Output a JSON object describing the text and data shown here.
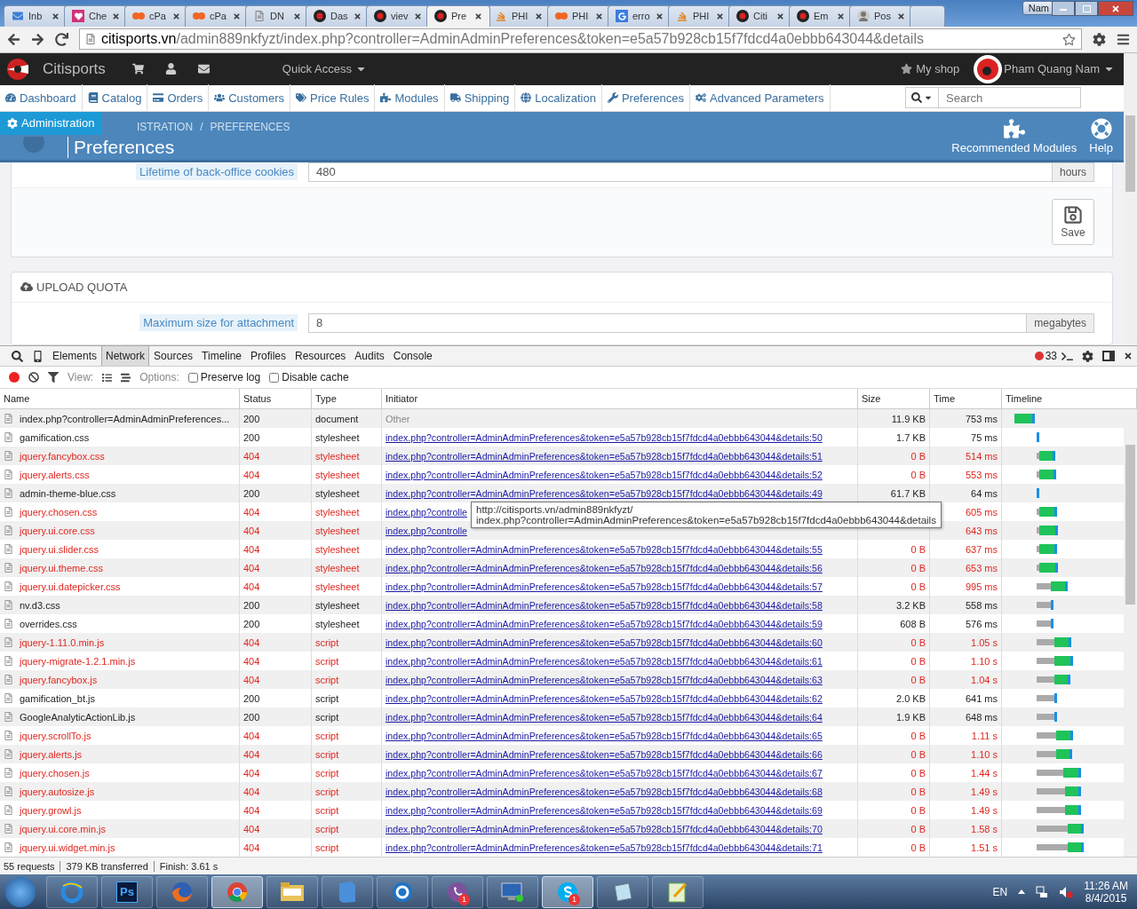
{
  "browser": {
    "tabs": [
      {
        "label": "Inb",
        "kind": "mail",
        "selected": false
      },
      {
        "label": "Che",
        "kind": "heart",
        "selected": false
      },
      {
        "label": "cPa",
        "kind": "cpanel",
        "selected": false
      },
      {
        "label": "cPa",
        "kind": "cpanel",
        "selected": false
      },
      {
        "label": "DN",
        "kind": "doc",
        "selected": false
      },
      {
        "label": "Das",
        "kind": "logo",
        "selected": false
      },
      {
        "label": "viev",
        "kind": "logo",
        "selected": false
      },
      {
        "label": "Pre",
        "kind": "logo",
        "selected": true
      },
      {
        "label": "PHI",
        "kind": "php",
        "selected": false
      },
      {
        "label": "PHI",
        "kind": "cpanel",
        "selected": false
      },
      {
        "label": "erro",
        "kind": "google",
        "selected": false
      },
      {
        "label": "PHI",
        "kind": "php",
        "selected": false
      },
      {
        "label": "Citi",
        "kind": "logo",
        "selected": false
      },
      {
        "label": "Em",
        "kind": "logo",
        "selected": false
      },
      {
        "label": "Pos",
        "kind": "person",
        "selected": false
      }
    ],
    "user_label": "Nam",
    "url_host": "citisports.vn",
    "url_path": "/admin889nkfyzt/index.php?controller=AdminAdminPreferences&token=e5a57b928cb15f7fdcd4a0ebbb643044&details"
  },
  "admin": {
    "shop_name": "Citisports",
    "quick_access": "Quick Access",
    "my_shop": "My shop",
    "user": "Pham Quang Nam",
    "menu": [
      "Dashboard",
      "Catalog",
      "Orders",
      "Customers",
      "Price Rules",
      "Modules",
      "Shipping",
      "Localization",
      "Preferences",
      "Advanced Parameters"
    ],
    "search_placeholder": "Search",
    "administration_button": "Administration",
    "breadcrumb": [
      "ISTRATION",
      "/",
      "PREFERENCES"
    ],
    "page_title": "Preferences",
    "toolbar": [
      "Recommended Modules",
      "Help"
    ],
    "cookie_field": {
      "label": "Lifetime of back-office cookies",
      "value": "480",
      "unit": "hours"
    },
    "save": "Save",
    "upload_panel": {
      "title": "UPLOAD QUOTA",
      "label": "Maximum size for attachment",
      "value": "8",
      "unit": "megabytes"
    }
  },
  "devtools": {
    "tabs": [
      {
        "label": "Elements",
        "selected": false
      },
      {
        "label": "Network",
        "selected": true
      },
      {
        "label": "Sources",
        "selected": false
      },
      {
        "label": "Timeline",
        "selected": false
      },
      {
        "label": "Profiles",
        "selected": false
      },
      {
        "label": "Resources",
        "selected": false
      },
      {
        "label": "Audits",
        "selected": false
      },
      {
        "label": "Console",
        "selected": false
      }
    ],
    "error_count": "33",
    "recording": true,
    "view_label": "View:",
    "options_label": "Options:",
    "options": [
      {
        "label": "Preserve log",
        "checked": false
      },
      {
        "label": "Disable cache",
        "checked": false
      }
    ],
    "columns": [
      "Name",
      "Status",
      "Type",
      "Initiator",
      "Size",
      "Time",
      "Timeline"
    ],
    "rows": [
      {
        "name": "index.php?controller=AdminAdminPreferences...",
        "status": "200",
        "type": "document",
        "initiator": "Other",
        "link": false,
        "size": "11.9 KB",
        "time": "753 ms",
        "failed": false
      },
      {
        "name": "gamification.css",
        "status": "200",
        "type": "stylesheet",
        "initiator": "index.php?controller=AdminAdminPreferences&token=e5a57b928cb15f7fdcd4a0ebbb643044&details:50",
        "link": true,
        "size": "1.7 KB",
        "time": "75 ms",
        "failed": false
      },
      {
        "name": "jquery.fancybox.css",
        "status": "404",
        "type": "stylesheet",
        "initiator": "index.php?controller=AdminAdminPreferences&token=e5a57b928cb15f7fdcd4a0ebbb643044&details:51",
        "link": true,
        "size": "0 B",
        "time": "514 ms",
        "failed": true
      },
      {
        "name": "jquery.alerts.css",
        "status": "404",
        "type": "stylesheet",
        "initiator": "index.php?controller=AdminAdminPreferences&token=e5a57b928cb15f7fdcd4a0ebbb643044&details:52",
        "link": true,
        "size": "0 B",
        "time": "553 ms",
        "failed": true
      },
      {
        "name": "admin-theme-blue.css",
        "status": "200",
        "type": "stylesheet",
        "initiator": "index.php?controller=AdminAdminPreferences&token=e5a57b928cb15f7fdcd4a0ebbb643044&details:49",
        "link": true,
        "size": "61.7 KB",
        "time": "64 ms",
        "failed": false
      },
      {
        "name": "jquery.chosen.css",
        "status": "404",
        "type": "stylesheet",
        "initiator": "index.php?controlle",
        "link": true,
        "time": "605 ms",
        "failed": true
      },
      {
        "name": "jquery.ui.core.css",
        "status": "404",
        "type": "stylesheet",
        "initiator": "index.php?controlle",
        "link": true,
        "time": "643 ms",
        "failed": true
      },
      {
        "name": "jquery.ui.slider.css",
        "status": "404",
        "type": "stylesheet",
        "initiator": "index.php?controller=AdminAdminPreferences&token=e5a57b928cb15f7fdcd4a0ebbb643044&details:55",
        "link": true,
        "size": "0 B",
        "time": "637 ms",
        "failed": true
      },
      {
        "name": "jquery.ui.theme.css",
        "status": "404",
        "type": "stylesheet",
        "initiator": "index.php?controller=AdminAdminPreferences&token=e5a57b928cb15f7fdcd4a0ebbb643044&details:56",
        "link": true,
        "size": "0 B",
        "time": "653 ms",
        "failed": true
      },
      {
        "name": "jquery.ui.datepicker.css",
        "status": "404",
        "type": "stylesheet",
        "initiator": "index.php?controller=AdminAdminPreferences&token=e5a57b928cb15f7fdcd4a0ebbb643044&details:57",
        "link": true,
        "size": "0 B",
        "time": "995 ms",
        "failed": true
      },
      {
        "name": "nv.d3.css",
        "status": "200",
        "type": "stylesheet",
        "initiator": "index.php?controller=AdminAdminPreferences&token=e5a57b928cb15f7fdcd4a0ebbb643044&details:58",
        "link": true,
        "size": "3.2 KB",
        "time": "558 ms",
        "failed": false
      },
      {
        "name": "overrides.css",
        "status": "200",
        "type": "stylesheet",
        "initiator": "index.php?controller=AdminAdminPreferences&token=e5a57b928cb15f7fdcd4a0ebbb643044&details:59",
        "link": true,
        "size": "608 B",
        "time": "576 ms",
        "failed": false
      },
      {
        "name": "jquery-1.11.0.min.js",
        "status": "404",
        "type": "script",
        "initiator": "index.php?controller=AdminAdminPreferences&token=e5a57b928cb15f7fdcd4a0ebbb643044&details:60",
        "link": true,
        "size": "0 B",
        "time": "1.05 s",
        "failed": true
      },
      {
        "name": "jquery-migrate-1.2.1.min.js",
        "status": "404",
        "type": "script",
        "initiator": "index.php?controller=AdminAdminPreferences&token=e5a57b928cb15f7fdcd4a0ebbb643044&details:61",
        "link": true,
        "size": "0 B",
        "time": "1.10 s",
        "failed": true
      },
      {
        "name": "jquery.fancybox.js",
        "status": "404",
        "type": "script",
        "initiator": "index.php?controller=AdminAdminPreferences&token=e5a57b928cb15f7fdcd4a0ebbb643044&details:63",
        "link": true,
        "size": "0 B",
        "time": "1.04 s",
        "failed": true
      },
      {
        "name": "gamification_bt.js",
        "status": "200",
        "type": "script",
        "initiator": "index.php?controller=AdminAdminPreferences&token=e5a57b928cb15f7fdcd4a0ebbb643044&details:62",
        "link": true,
        "size": "2.0 KB",
        "time": "641 ms",
        "failed": false
      },
      {
        "name": "GoogleAnalyticActionLib.js",
        "status": "200",
        "type": "script",
        "initiator": "index.php?controller=AdminAdminPreferences&token=e5a57b928cb15f7fdcd4a0ebbb643044&details:64",
        "link": true,
        "size": "1.9 KB",
        "time": "648 ms",
        "failed": false
      },
      {
        "name": "jquery.scrollTo.js",
        "status": "404",
        "type": "script",
        "initiator": "index.php?controller=AdminAdminPreferences&token=e5a57b928cb15f7fdcd4a0ebbb643044&details:65",
        "link": true,
        "size": "0 B",
        "time": "1.11 s",
        "failed": true
      },
      {
        "name": "jquery.alerts.js",
        "status": "404",
        "type": "script",
        "initiator": "index.php?controller=AdminAdminPreferences&token=e5a57b928cb15f7fdcd4a0ebbb643044&details:66",
        "link": true,
        "size": "0 B",
        "time": "1.10 s",
        "failed": true
      },
      {
        "name": "jquery.chosen.js",
        "status": "404",
        "type": "script",
        "initiator": "index.php?controller=AdminAdminPreferences&token=e5a57b928cb15f7fdcd4a0ebbb643044&details:67",
        "link": true,
        "size": "0 B",
        "time": "1.44 s",
        "failed": true
      },
      {
        "name": "jquery.autosize.js",
        "status": "404",
        "type": "script",
        "initiator": "index.php?controller=AdminAdminPreferences&token=e5a57b928cb15f7fdcd4a0ebbb643044&details:68",
        "link": true,
        "size": "0 B",
        "time": "1.49 s",
        "failed": true
      },
      {
        "name": "jquery.growl.js",
        "status": "404",
        "type": "script",
        "initiator": "index.php?controller=AdminAdminPreferences&token=e5a57b928cb15f7fdcd4a0ebbb643044&details:69",
        "link": true,
        "size": "0 B",
        "time": "1.49 s",
        "failed": true
      },
      {
        "name": "jquery.ui.core.min.js",
        "status": "404",
        "type": "script",
        "initiator": "index.php?controller=AdminAdminPreferences&token=e5a57b928cb15f7fdcd4a0ebbb643044&details:70",
        "link": true,
        "size": "0 B",
        "time": "1.58 s",
        "failed": true
      },
      {
        "name": "jquery.ui.widget.min.js",
        "status": "404",
        "type": "script",
        "initiator": "index.php?controller=AdminAdminPreferences&token=e5a57b928cb15f7fdcd4a0ebbb643044&details:71",
        "link": true,
        "size": "0 B",
        "time": "1.51 s",
        "failed": true
      }
    ],
    "tooltip": [
      "http://citisports.vn/admin889nkfyzt/",
      "index.php?controller=AdminAdminPreferences&token=e5a57b928cb15f7fdcd4a0ebbb643044&details"
    ],
    "status": [
      "55 requests",
      "379 KB transferred",
      "Finish: 3.61 s"
    ]
  },
  "taskbar": {
    "apps": [
      {
        "kind": "ie",
        "selected": false
      },
      {
        "kind": "ps",
        "label": "Ps",
        "selected": false
      },
      {
        "kind": "firefox",
        "selected": false
      },
      {
        "kind": "chrome",
        "selected": true
      },
      {
        "kind": "folder",
        "selected": false
      },
      {
        "kind": "book",
        "selected": false
      },
      {
        "kind": "cc",
        "selected": false
      },
      {
        "kind": "viber",
        "badge": "1",
        "selected": false
      },
      {
        "kind": "remote",
        "selected": false
      },
      {
        "kind": "skype",
        "badge": "1",
        "selected": true
      },
      {
        "kind": "notepad",
        "selected": false
      },
      {
        "kind": "notepadpp",
        "selected": false
      }
    ],
    "language": "EN",
    "time": "11:26 AM",
    "date": "8/4/2015"
  }
}
